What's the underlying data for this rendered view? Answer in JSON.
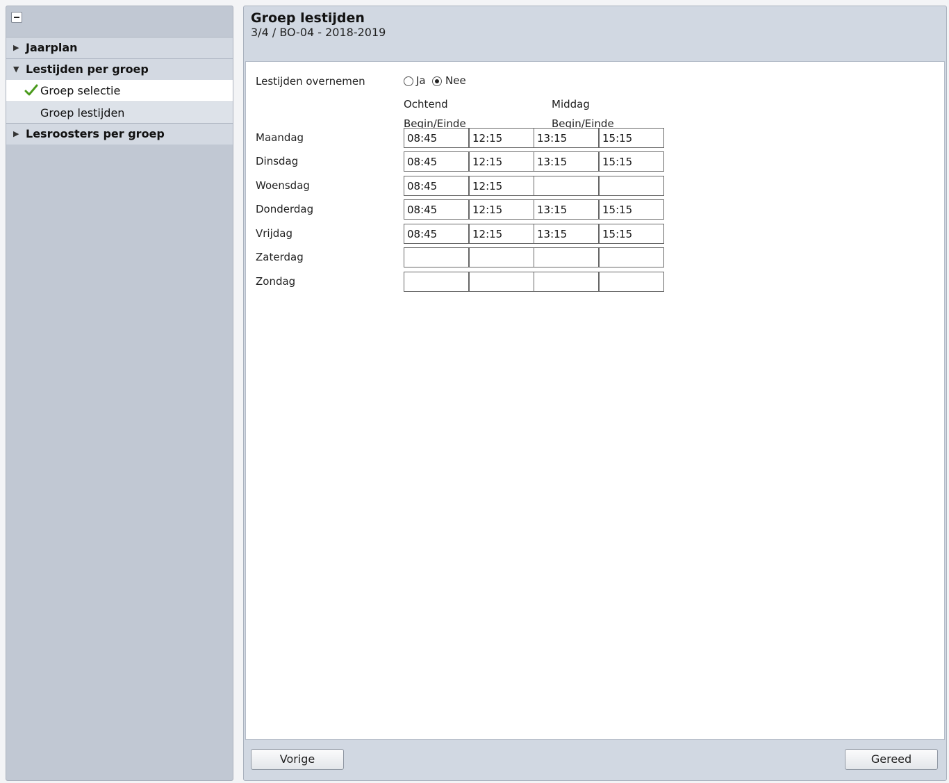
{
  "sidebar": {
    "sections": [
      {
        "label": "Jaarplan",
        "expanded": false
      },
      {
        "label": "Lestijden per groep",
        "expanded": true,
        "items": [
          {
            "label": "Groep selectie",
            "done": true
          },
          {
            "label": "Groep lestijden",
            "done": false
          }
        ]
      },
      {
        "label": "Lesroosters per groep",
        "expanded": false
      }
    ]
  },
  "header": {
    "title": "Groep lestijden",
    "subtitle": "3/4 / BO-04 - 2018-2019"
  },
  "form": {
    "overnemen_label": "Lestijden overnemen",
    "radio_ja": "Ja",
    "radio_nee": "Nee",
    "selected": "Nee",
    "ochtend_label": "Ochtend",
    "middag_label": "Middag",
    "begin_einde_label_1": "Begin/Einde",
    "begin_einde_label_2": "Begin/Einde",
    "days": [
      {
        "name": "Maandag",
        "times": [
          "08:45",
          "12:15",
          "13:15",
          "15:15"
        ]
      },
      {
        "name": "Dinsdag",
        "times": [
          "08:45",
          "12:15",
          "13:15",
          "15:15"
        ]
      },
      {
        "name": "Woensdag",
        "times": [
          "08:45",
          "12:15",
          "",
          ""
        ]
      },
      {
        "name": "Donderdag",
        "times": [
          "08:45",
          "12:15",
          "13:15",
          "15:15"
        ]
      },
      {
        "name": "Vrijdag",
        "times": [
          "08:45",
          "12:15",
          "13:15",
          "15:15"
        ]
      },
      {
        "name": "Zaterdag",
        "times": [
          "",
          "",
          "",
          ""
        ]
      },
      {
        "name": "Zondag",
        "times": [
          "",
          "",
          "",
          ""
        ]
      }
    ]
  },
  "footer": {
    "prev_label": "Vorige",
    "done_label": "Gereed"
  },
  "colors": {
    "panel_bg": "#c1c8d3",
    "header_bg": "#d1d8e2",
    "check_green": "#4a9a1c"
  }
}
